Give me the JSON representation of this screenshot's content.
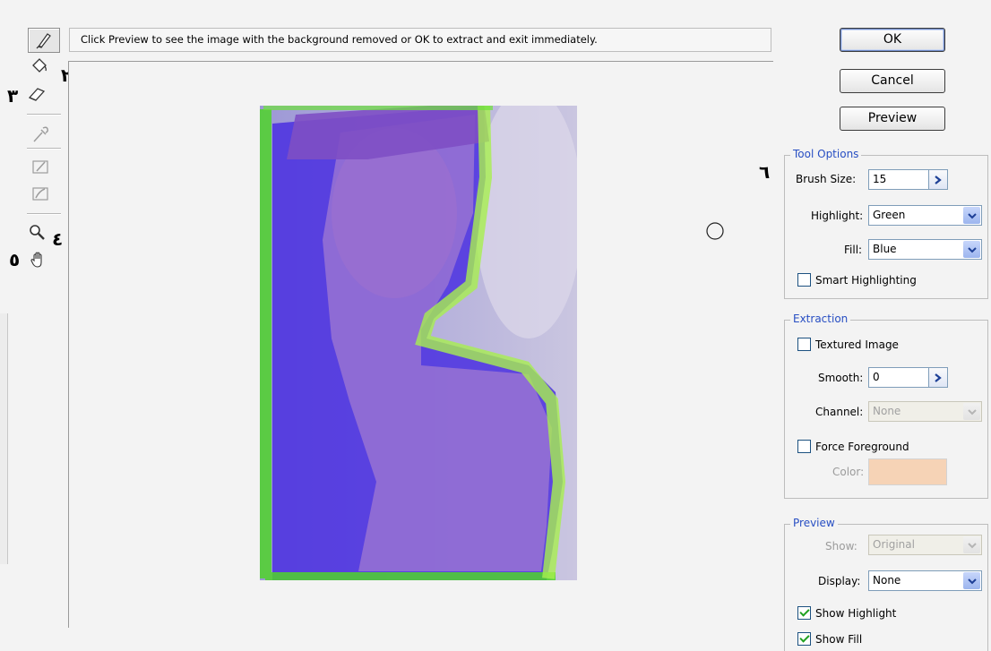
{
  "instruction": "Click Preview to see the image with the background removed or OK to extract and exit immediately.",
  "toolbar": {
    "numbers": {
      "n2": "٢",
      "n3": "٣",
      "n4": "٤",
      "n5": "٥",
      "n6": "٦"
    }
  },
  "buttons": {
    "ok": "OK",
    "cancel": "Cancel",
    "preview": "Preview"
  },
  "tool_options": {
    "title": "Tool Options",
    "brush_size_label": "Brush Size:",
    "brush_size_value": "15",
    "highlight_label": "Highlight:",
    "highlight_value": "Green",
    "fill_label": "Fill:",
    "fill_value": "Blue",
    "smart_highlighting_label": "Smart Highlighting",
    "smart_highlighting_checked": false
  },
  "extraction": {
    "title": "Extraction",
    "textured_image_label": "Textured Image",
    "textured_image_checked": false,
    "smooth_label": "Smooth:",
    "smooth_value": "0",
    "channel_label": "Channel:",
    "channel_value": "None",
    "force_foreground_label": "Force Foreground",
    "force_foreground_checked": false,
    "color_label": "Color:",
    "color_swatch": "#f6d3b6"
  },
  "preview": {
    "title": "Preview",
    "show_label": "Show:",
    "show_value": "Original",
    "display_label": "Display:",
    "display_value": "None",
    "show_highlight_label": "Show Highlight",
    "show_highlight_checked": true,
    "show_fill_label": "Show Fill",
    "show_fill_checked": true
  },
  "colors": {
    "accent": "#274ec3",
    "highlight_green": "#4fd42a",
    "fill_blue": "#4a2fe0"
  },
  "icons": [
    "edge-highlighter-icon",
    "fill-bucket-icon",
    "eraser-icon",
    "eyedropper-icon",
    "cleanup-tool-icon",
    "edge-touchup-icon",
    "zoom-icon",
    "hand-icon",
    "brush-cursor-icon"
  ]
}
